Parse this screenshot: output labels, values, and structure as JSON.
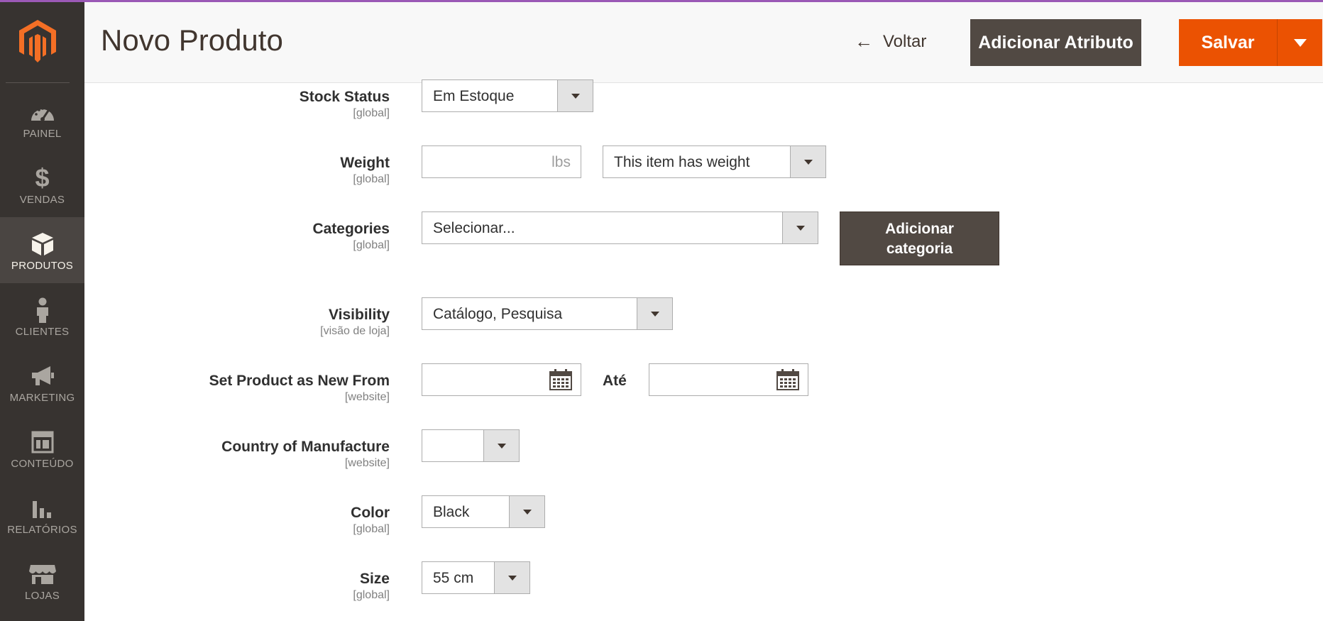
{
  "header": {
    "title": "Novo Produto",
    "back_label": "Voltar",
    "add_attribute_label": "Adicionar Atributo",
    "save_label": "Salvar"
  },
  "sidebar": {
    "items": [
      {
        "label": "PAINEL",
        "icon": "dashboard-icon"
      },
      {
        "label": "VENDAS",
        "icon": "dollar-icon"
      },
      {
        "label": "PRODUTOS",
        "icon": "box-icon",
        "active": true
      },
      {
        "label": "CLIENTES",
        "icon": "person-icon"
      },
      {
        "label": "MARKETING",
        "icon": "megaphone-icon"
      },
      {
        "label": "CONTEÚDO",
        "icon": "layout-icon"
      },
      {
        "label": "RELATÓRIOS",
        "icon": "bar-chart-icon"
      },
      {
        "label": "LOJAS",
        "icon": "store-icon"
      }
    ]
  },
  "form": {
    "stock_status": {
      "label": "Stock Status",
      "scope": "[global]",
      "value": "Em Estoque"
    },
    "weight": {
      "label": "Weight",
      "scope": "[global]",
      "value": "",
      "unit": "lbs",
      "type_value": "This item has weight"
    },
    "categories": {
      "label": "Categories",
      "scope": "[global]",
      "placeholder": "Selecionar...",
      "add_button": "Adicionar categoria",
      "add_button_line1": "Adicionar",
      "add_button_line2": "categoria"
    },
    "visibility": {
      "label": "Visibility",
      "scope": "[visão de loja]",
      "value": "Catálogo, Pesquisa"
    },
    "new_from": {
      "label": "Set Product as New From",
      "scope": "[website]",
      "from_value": "",
      "to_label": "Até",
      "to_value": ""
    },
    "country": {
      "label": "Country of Manufacture",
      "scope": "[website]",
      "value": ""
    },
    "color": {
      "label": "Color",
      "scope": "[global]",
      "value": "Black"
    },
    "size": {
      "label": "Size",
      "scope": "[global]",
      "value": "55 cm"
    }
  },
  "colors": {
    "sidebar_bg": "#373330",
    "primary": "#eb5202",
    "secondary": "#514943",
    "accent_line": "#9b59b6"
  }
}
